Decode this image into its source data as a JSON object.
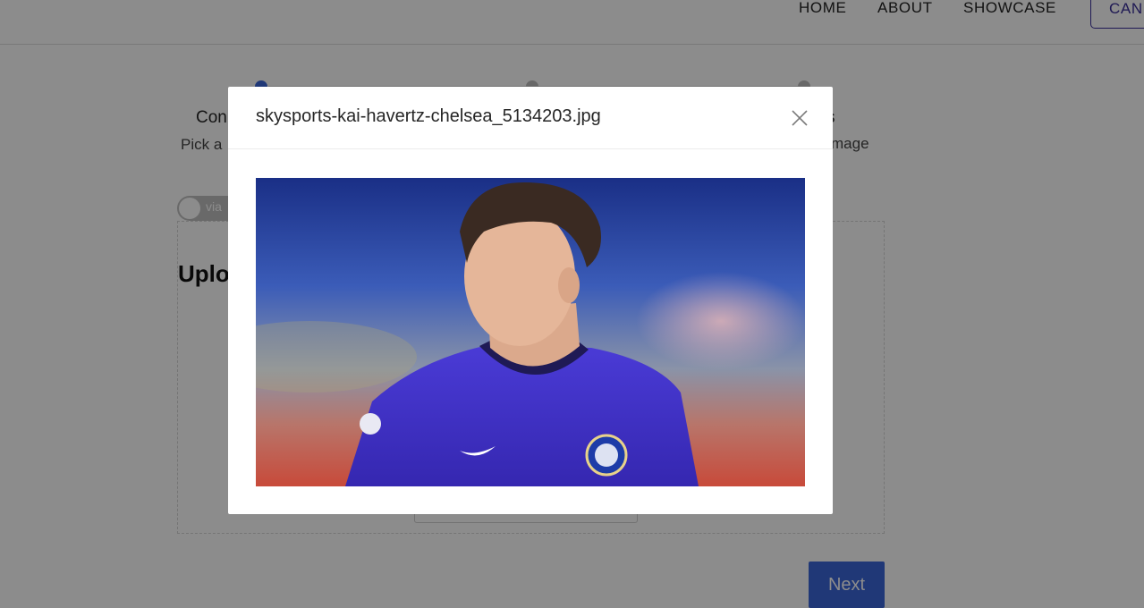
{
  "nav": {
    "links": [
      "HOME",
      "ABOUT",
      "SHOWCASE"
    ],
    "cta": "CAN"
  },
  "steps": [
    {
      "title": "Con",
      "subtitle": "Pick a"
    },
    {
      "title": "",
      "subtitle": ""
    },
    {
      "title": "s",
      "subtitle": "mage"
    }
  ],
  "toggle": {
    "label": "via"
  },
  "upload": {
    "title": "Uplo"
  },
  "next_button": "Next",
  "modal": {
    "title": "skysports-kai-havertz-chelsea_5134203.jpg"
  },
  "colors": {
    "accent": "#3b66d9",
    "cta_outline": "#3a2f9a",
    "jersey_blue": "#3d2fc2"
  }
}
